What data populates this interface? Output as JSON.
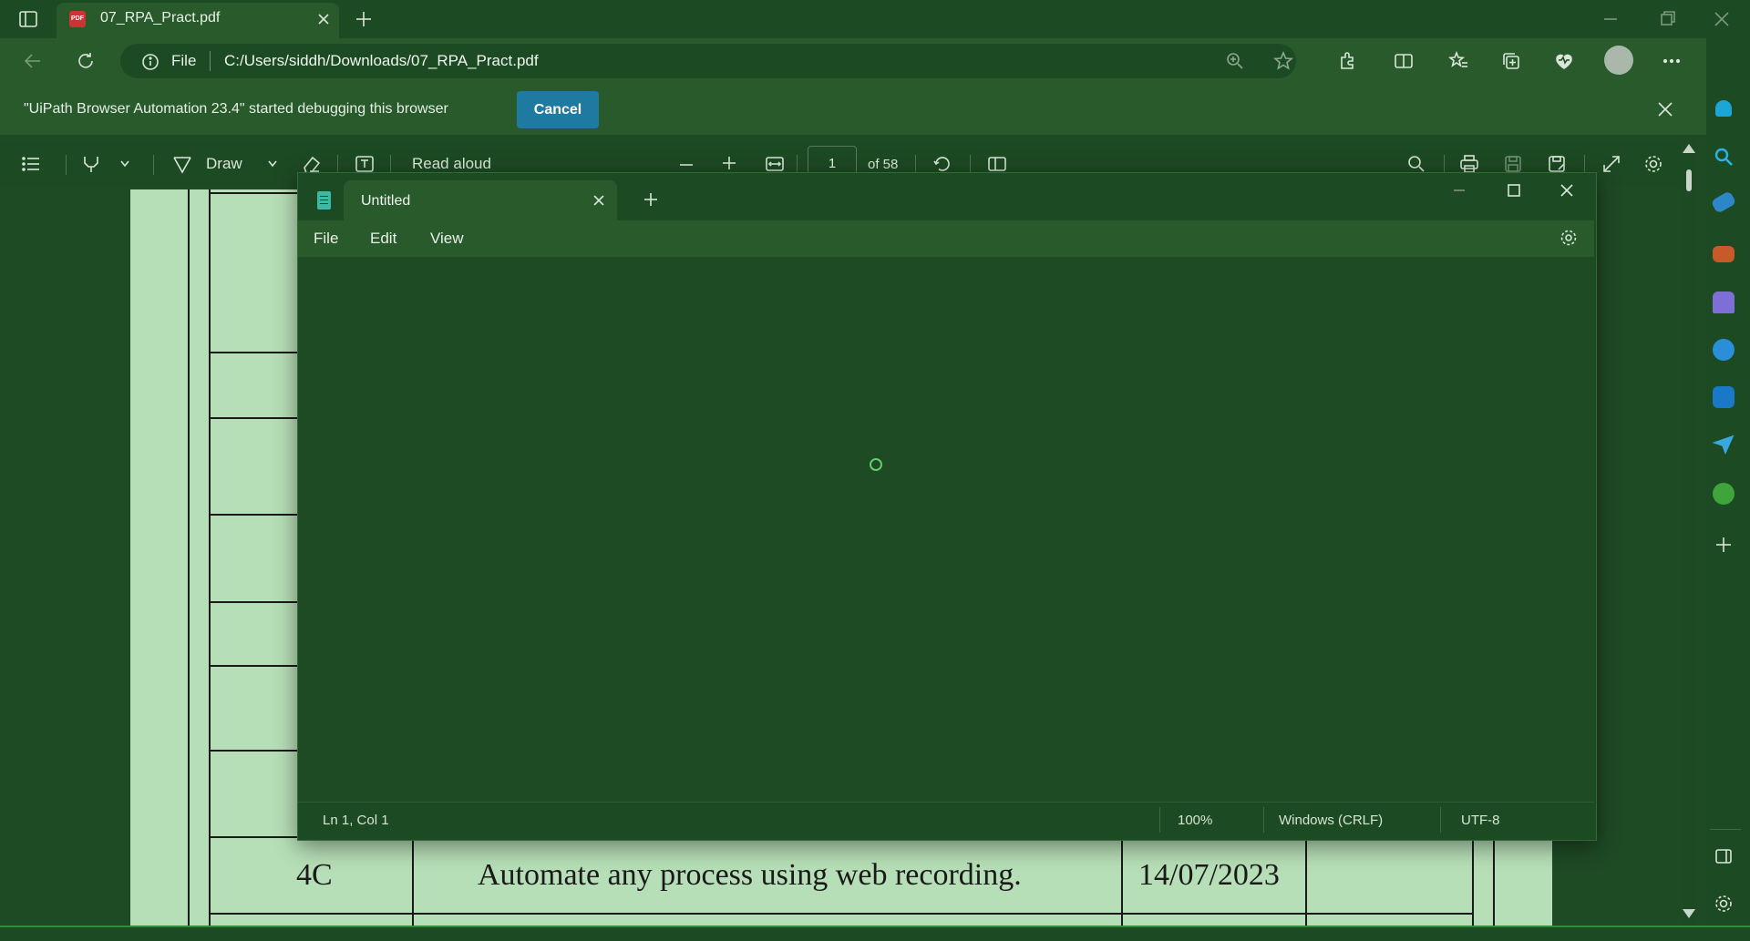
{
  "browser": {
    "tab_title": "07_RPA_Pract.pdf",
    "pdf_badge": "PDF",
    "address": {
      "scheme_label": "File",
      "url": "C:/Users/siddh/Downloads/07_RPA_Pract.pdf"
    },
    "infobar": {
      "message": "\"UiPath Browser Automation 23.4\" started debugging this browser",
      "cancel_label": "Cancel"
    }
  },
  "pdf_toolbar": {
    "draw_label": "Draw",
    "read_aloud_label": "Read aloud",
    "page_current": "1",
    "page_total": "of 58"
  },
  "pdf_content": {
    "row": {
      "id": "4C",
      "description": "Automate any process using web recording.",
      "date": "14/07/2023"
    }
  },
  "notepad": {
    "tab_title": "Untitled",
    "menu": [
      "File",
      "Edit",
      "View"
    ],
    "status": {
      "position": "Ln 1, Col 1",
      "zoom": "100%",
      "line_ending": "Windows (CRLF)",
      "encoding": "UTF-8"
    }
  },
  "colors": {
    "theme_green": "#1e4a24",
    "page_green": "#b7dfb7",
    "cancel_blue": "#1f7aa1"
  },
  "icons": {
    "sidebar": [
      "bell-icon",
      "search-icon",
      "tag-icon",
      "briefcase-icon",
      "chess-icon",
      "copilot-icon",
      "outlook-icon",
      "send-icon",
      "tree-icon",
      "add-icon",
      "panel-icon",
      "settings-icon"
    ]
  }
}
